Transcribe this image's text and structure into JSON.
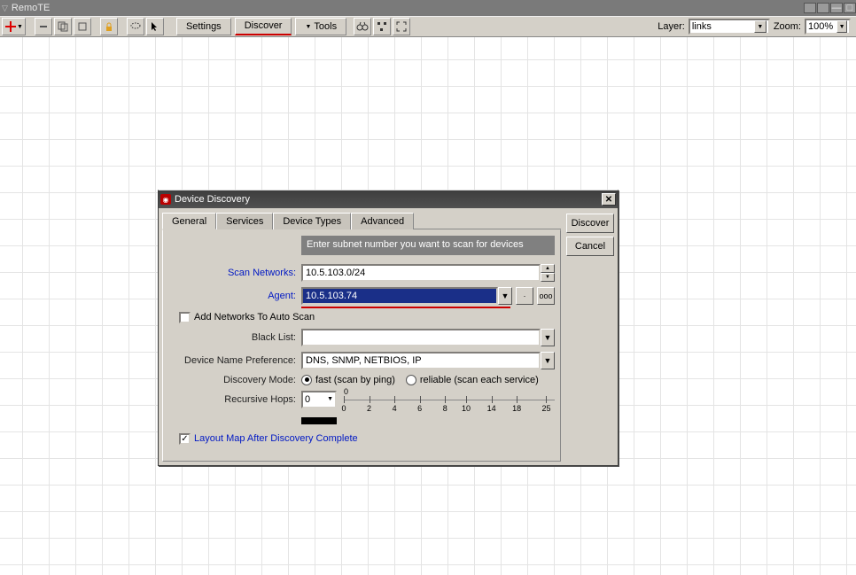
{
  "titlebar": {
    "title": "RemoTE"
  },
  "toolbar": {
    "settings": "Settings",
    "discover": "Discover",
    "tools": "Tools",
    "layer_label": "Layer:",
    "layer_value": "links",
    "zoom_label": "Zoom:",
    "zoom_value": "100%"
  },
  "dialog": {
    "title": "Device Discovery",
    "tabs": {
      "general": "General",
      "services": "Services",
      "device_types": "Device Types",
      "advanced": "Advanced"
    },
    "discover_btn": "Discover",
    "cancel_btn": "Cancel",
    "hint": "Enter subnet number you want to scan for devices",
    "scan_networks_label": "Scan Networks:",
    "scan_networks_value": "10.5.103.0/24",
    "agent_label": "Agent:",
    "agent_value": "10.5.103.74",
    "add_auto_scan_label": "Add Networks To Auto Scan",
    "black_list_label": "Black List:",
    "black_list_value": "",
    "dn_pref_label": "Device Name Preference:",
    "dn_pref_value": "DNS, SNMP, NETBIOS, IP",
    "disc_mode_label": "Discovery Mode:",
    "mode_fast": "fast (scan by ping)",
    "mode_reliable": "reliable (scan each service)",
    "rec_hops_label": "Recursive Hops:",
    "rec_hops_value": "0",
    "ruler": {
      "marker": "0",
      "ticks": [
        "0",
        "2",
        "4",
        "6",
        "8",
        "10",
        "14",
        "18",
        "25"
      ]
    },
    "layout_after_label": "Layout Map After Discovery Complete"
  }
}
